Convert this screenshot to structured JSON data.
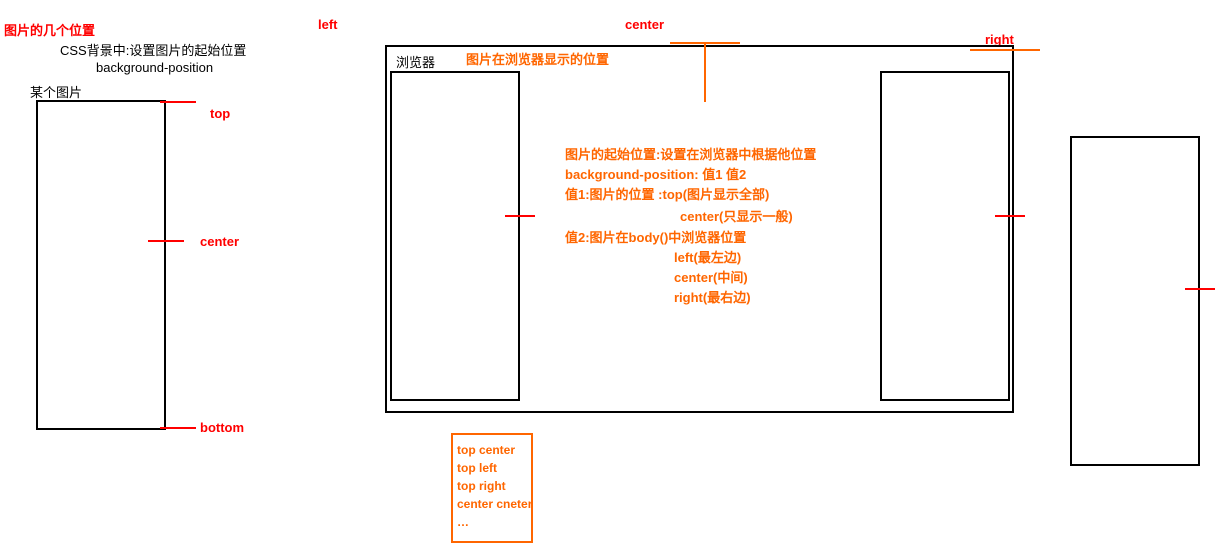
{
  "left_panel": {
    "title": "图片的几个位置",
    "subtitle1": "CSS背景中:设置图片的起始位置",
    "subtitle2": "background-position",
    "image_label": "某个图片",
    "pos_top": "top",
    "pos_center": "center",
    "pos_bottom": "bottom"
  },
  "browser": {
    "label_left": "left",
    "label_center": "center",
    "label_right": "right",
    "browser_text": "浏览器",
    "caption": "图片在浏览器显示的位置",
    "body": {
      "l1": "图片的起始位置:设置在浏览器中根据他位置",
      "l2": "background-position: 值1 值2",
      "l3": "值1:图片的位置 :top(图片显示全部)",
      "l4": "center(只显示一般)",
      "l5": "值2:图片在body()中浏览器位置",
      "l6": "left(最左边)",
      "l7": "center(中间)",
      "l8": "right(最右边)"
    }
  },
  "combos": {
    "c1": "top  center",
    "c2": "top left",
    "c3": "top right",
    "c4": "center cneter",
    "c5": "…"
  },
  "chart_data": {
    "type": "table",
    "title": "CSS background-position 值组合",
    "series": [
      {
        "name": "值1 (图片的位置)",
        "values": [
          "top",
          "center",
          "bottom"
        ],
        "notes": [
          "图片显示全部",
          "只显示一般",
          ""
        ]
      },
      {
        "name": "值2 (图片在body()中浏览器位置)",
        "values": [
          "left",
          "center",
          "right"
        ],
        "notes": [
          "最左边",
          "中间",
          "最右边"
        ]
      }
    ],
    "combinations": [
      "top center",
      "top left",
      "top right",
      "center center",
      "…"
    ]
  }
}
